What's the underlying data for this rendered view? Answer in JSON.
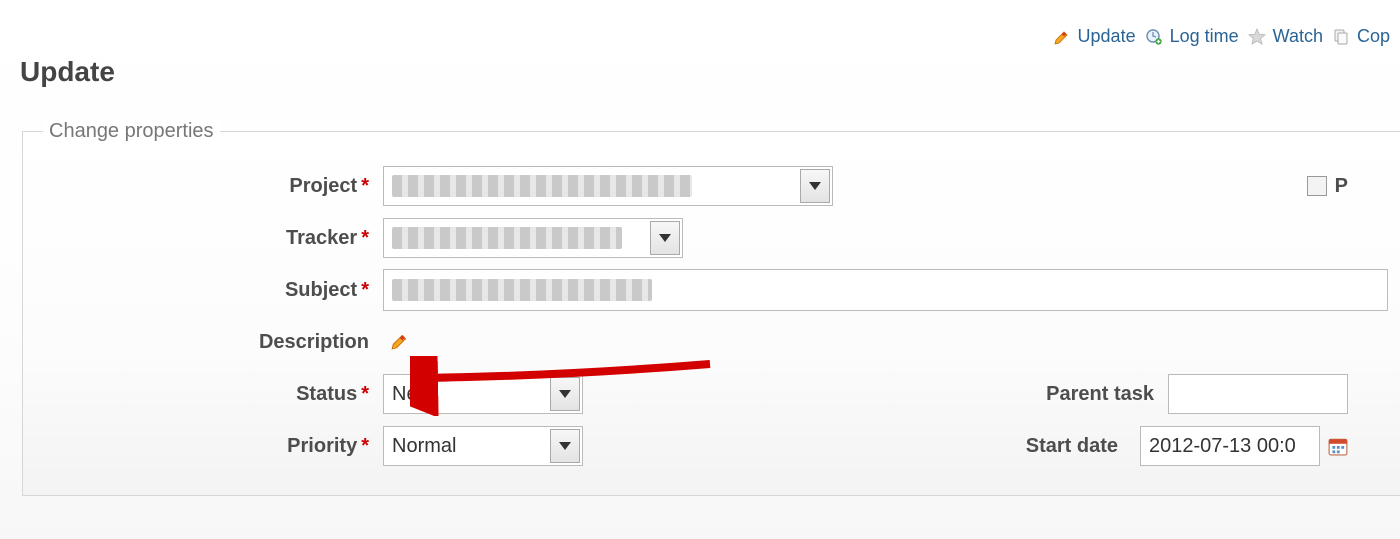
{
  "actions": {
    "update": "Update",
    "log_time": "Log time",
    "watch": "Watch",
    "copy": "Cop"
  },
  "page_title": "Update",
  "legend": "Change properties",
  "labels": {
    "project": "Project",
    "tracker": "Tracker",
    "subject": "Subject",
    "description": "Description",
    "status": "Status",
    "priority": "Priority",
    "parent_task": "Parent task",
    "start_date": "Start date",
    "private": "P"
  },
  "fields": {
    "project": "",
    "tracker": "",
    "subject": "",
    "status": "New",
    "priority": "Normal",
    "parent_task": "",
    "start_date": "2012-07-13 00:0"
  },
  "select_widths": {
    "project": 450,
    "tracker": 300,
    "status": 200,
    "priority": 200
  }
}
